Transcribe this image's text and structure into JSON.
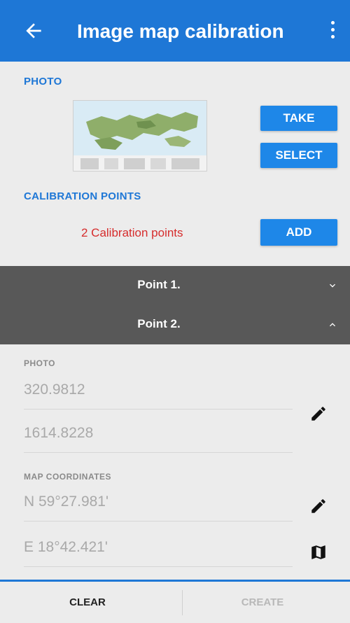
{
  "appbar": {
    "title": "Image map calibration",
    "icons": {
      "back": "arrow-back-icon",
      "menu": "more-vert-icon"
    }
  },
  "photo_section": {
    "label": "PHOTO",
    "take_label": "TAKE",
    "select_label": "SELECT"
  },
  "calibration_section": {
    "label": "CALIBRATION POINTS",
    "count_text": "2 Calibration points",
    "add_label": "ADD"
  },
  "points": [
    {
      "label": "Point 1.",
      "expanded": false
    },
    {
      "label": "Point 2.",
      "expanded": true
    }
  ],
  "point_detail": {
    "photo_label": "PHOTO",
    "photo_x": "320.9812",
    "photo_y": "1614.8228",
    "map_label": "MAP COORDINATES",
    "lat": "N 59°27.981'",
    "lon": "E 18°42.421'"
  },
  "bottombar": {
    "clear_label": "CLEAR",
    "create_label": "CREATE"
  },
  "colors": {
    "accent": "#1e77d6",
    "button": "#1e87e8",
    "count_text": "#d62c2c",
    "point_row": "#585858"
  }
}
